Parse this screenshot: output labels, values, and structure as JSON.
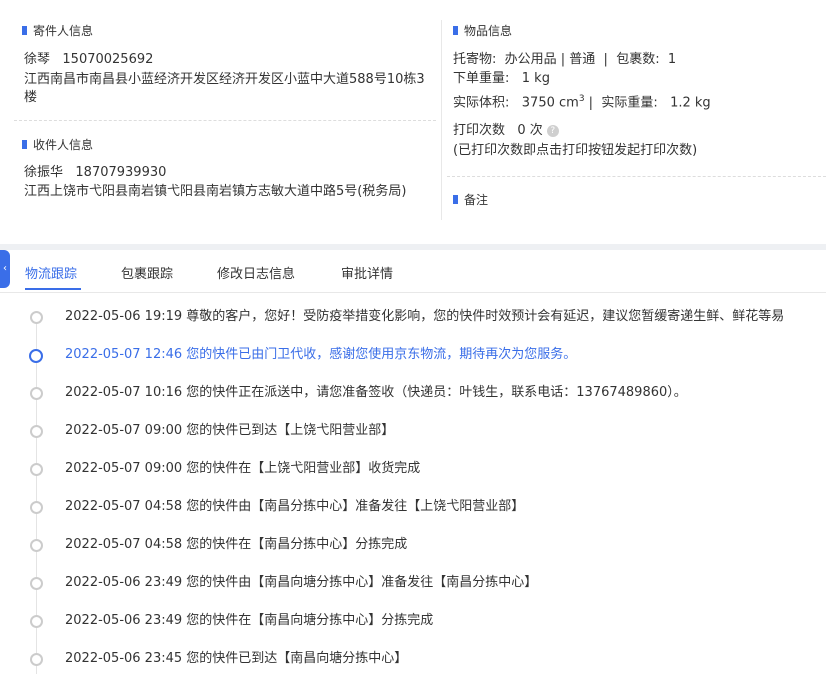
{
  "sender": {
    "title": "寄件人信息",
    "name_phone": "徐琴   15070025692",
    "address": "江西南昌市南昌县小蓝经济开发区经济开发区小蓝中大道588号10栋3楼"
  },
  "receiver": {
    "title": "收件人信息",
    "name_phone": "徐振华   18707939930",
    "address": "江西上饶市弋阳县南岩镇弋阳县南岩镇方志敏大道中路5号(税务局)"
  },
  "goods": {
    "title": "物品信息",
    "line1": "托寄物:  办公用品 | 普通  |  包裹数:  1",
    "line2": "下单重量:   1 kg",
    "line3_prefix": "实际体积:   3750 cm",
    "line3_sup": "3",
    "line3_suffix": " |  实际重量:   1.2 kg",
    "print_label": "打印次数   0 次",
    "print_note": "(已打印次数即点击打印按钮发起打印次数)",
    "help_icon": "question-circle-icon"
  },
  "remark": {
    "title": "备注"
  },
  "colors": {
    "accent": "#3a6ee8",
    "text": "#333333",
    "divider": "#e8e8e8"
  },
  "tabs": [
    {
      "label": "物流跟踪",
      "active": true
    },
    {
      "label": "包裹跟踪"
    },
    {
      "label": "修改日志信息"
    },
    {
      "label": "审批详情"
    }
  ],
  "timeline": [
    {
      "text": "2022-05-06 19:19 尊敬的客户，您好！受防疫举措变化影响，您的快件时效预计会有延迟，建议您暂缓寄递生鲜、鲜花等易"
    },
    {
      "text": "2022-05-07 12:46 您的快件已由门卫代收，感谢您使用京东物流，期待再次为您服务。",
      "active": true
    },
    {
      "text": "2022-05-07 10:16 您的快件正在派送中，请您准备签收（快递员：叶钱生，联系电话：13767489860）。"
    },
    {
      "text": "2022-05-07 09:00 您的快件已到达【上饶弋阳营业部】"
    },
    {
      "text": "2022-05-07 09:00 您的快件在【上饶弋阳营业部】收货完成"
    },
    {
      "text": "2022-05-07 04:58 您的快件由【南昌分拣中心】准备发往【上饶弋阳营业部】"
    },
    {
      "text": "2022-05-07 04:58 您的快件在【南昌分拣中心】分拣完成"
    },
    {
      "text": "2022-05-06 23:49 您的快件由【南昌向塘分拣中心】准备发往【南昌分拣中心】"
    },
    {
      "text": "2022-05-06 23:49 您的快件在【南昌向塘分拣中心】分拣完成"
    },
    {
      "text": "2022-05-06 23:45 您的快件已到达【南昌向塘分拣中心】"
    }
  ]
}
